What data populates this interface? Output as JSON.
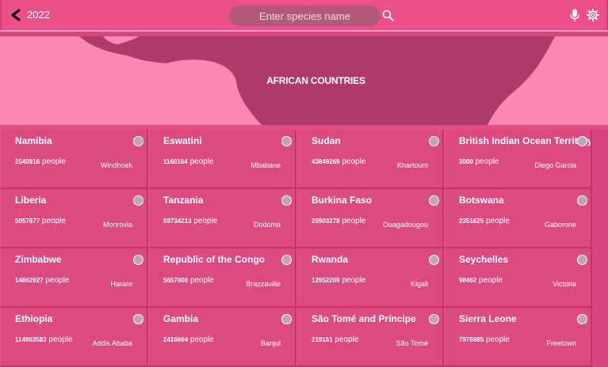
{
  "header": {
    "year": "2022",
    "search_placeholder": "Enter species name",
    "icons": [
      "back-arrow-icon",
      "search-icon",
      "microphone-icon",
      "gear-icon"
    ]
  },
  "banner": {
    "title": "AFRICAN COUNTRIES"
  },
  "colors": {
    "topbar": "#ec4f8a",
    "banner_light": "#fd88b3",
    "banner_dark": "#b23a6a",
    "card": "#dd4a82",
    "card_border": "#c8336c"
  },
  "countries": [
    {
      "name": "Namibia",
      "population": "2540916",
      "unit": "people",
      "capital": "Windhoek"
    },
    {
      "name": "Eswatini",
      "population": "1160164",
      "unit": "people",
      "capital": "Mbabane"
    },
    {
      "name": "Sudan",
      "population": "43849269",
      "unit": "people",
      "capital": "Khartoum"
    },
    {
      "name": "British Indian Ocean Territory",
      "population": "3000",
      "unit": "people",
      "capital": "Diego Garcia"
    },
    {
      "name": "Liberia",
      "population": "5057677",
      "unit": "people",
      "capital": "Monrovia"
    },
    {
      "name": "Tanzania",
      "population": "59734213",
      "unit": "people",
      "capital": "Dodoma"
    },
    {
      "name": "Burkina Faso",
      "population": "20903278",
      "unit": "people",
      "capital": "Ouagadougou"
    },
    {
      "name": "Botswana",
      "population": "2351625",
      "unit": "people",
      "capital": "Gaborone"
    },
    {
      "name": "Zimbabwe",
      "population": "14862927",
      "unit": "people",
      "capital": "Harare"
    },
    {
      "name": "Republic of the Congo",
      "population": "5657000",
      "unit": "people",
      "capital": "Brazzaville"
    },
    {
      "name": "Rwanda",
      "population": "12952209",
      "unit": "people",
      "capital": "Kigali"
    },
    {
      "name": "Seychelles",
      "population": "98462",
      "unit": "people",
      "capital": "Victoria"
    },
    {
      "name": "Ethiopia",
      "population": "114963583",
      "unit": "people",
      "capital": "Addis Ababa"
    },
    {
      "name": "Gambia",
      "population": "2416664",
      "unit": "people",
      "capital": "Banjul"
    },
    {
      "name": "São Tomé and Príncipe",
      "population": "219161",
      "unit": "people",
      "capital": "São Tomé"
    },
    {
      "name": "Sierra Leone",
      "population": "7976985",
      "unit": "people",
      "capital": "Freetown"
    }
  ]
}
